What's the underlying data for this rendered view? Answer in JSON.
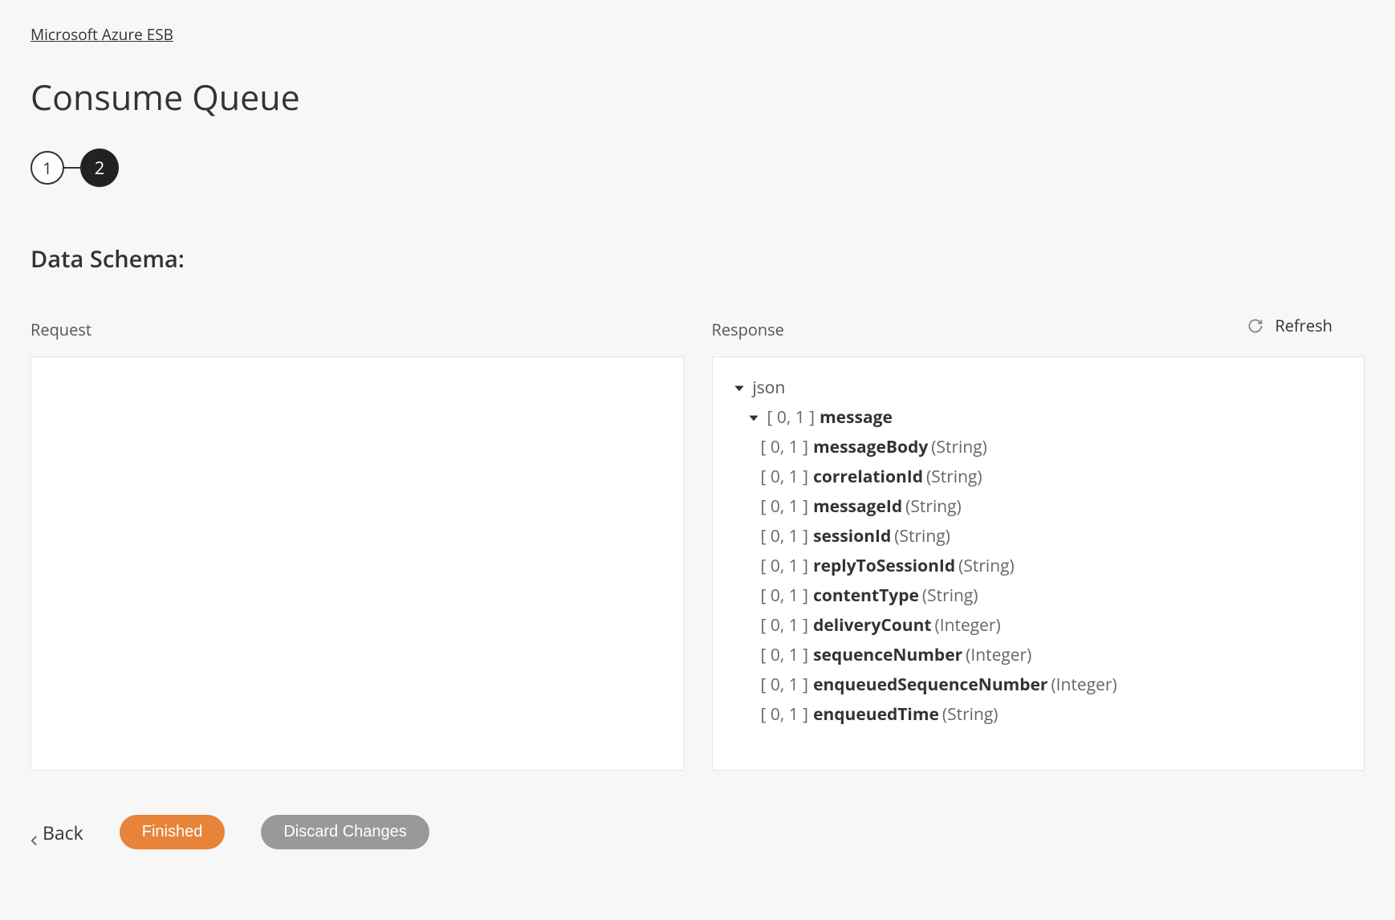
{
  "breadcrumb": {
    "label": "Microsoft Azure ESB"
  },
  "page": {
    "title": "Consume Queue",
    "section_title": "Data Schema:"
  },
  "stepper": {
    "step1": "1",
    "step2": "2"
  },
  "refresh": {
    "label": "Refresh"
  },
  "columns": {
    "request": {
      "label": "Request"
    },
    "response": {
      "label": "Response"
    }
  },
  "schema": {
    "root": {
      "label": "json"
    },
    "message": {
      "cardinality": "[ 0, 1 ]",
      "name": "message"
    },
    "fields": [
      {
        "cardinality": "[ 0, 1 ]",
        "name": "messageBody",
        "type": "(String)"
      },
      {
        "cardinality": "[ 0, 1 ]",
        "name": "correlationId",
        "type": "(String)"
      },
      {
        "cardinality": "[ 0, 1 ]",
        "name": "messageId",
        "type": "(String)"
      },
      {
        "cardinality": "[ 0, 1 ]",
        "name": "sessionId",
        "type": "(String)"
      },
      {
        "cardinality": "[ 0, 1 ]",
        "name": "replyToSessionId",
        "type": "(String)"
      },
      {
        "cardinality": "[ 0, 1 ]",
        "name": "contentType",
        "type": "(String)"
      },
      {
        "cardinality": "[ 0, 1 ]",
        "name": "deliveryCount",
        "type": "(Integer)"
      },
      {
        "cardinality": "[ 0, 1 ]",
        "name": "sequenceNumber",
        "type": "(Integer)"
      },
      {
        "cardinality": "[ 0, 1 ]",
        "name": "enqueuedSequenceNumber",
        "type": "(Integer)"
      },
      {
        "cardinality": "[ 0, 1 ]",
        "name": "enqueuedTime",
        "type": "(String)"
      }
    ]
  },
  "footer": {
    "back": "Back",
    "finished": "Finished",
    "discard": "Discard Changes"
  }
}
